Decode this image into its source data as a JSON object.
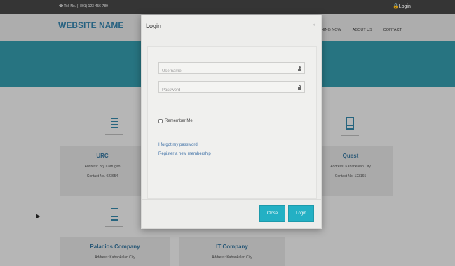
{
  "topbar": {
    "phone": "☎ Toll No. (+801) 123-456-789",
    "login": "🔒Login"
  },
  "site": {
    "brand": "WEBSITE NAME",
    "nav": [
      "HING NOW",
      "ABOUT US",
      "CONTACT"
    ]
  },
  "companies": [
    {
      "name": "URC",
      "address": "Address: Bry Carrugao",
      "contact": "Contact No. 023654"
    },
    {
      "name": "Quest",
      "address": "Address: Kabankalan City",
      "contact": "Contact No. 123165"
    },
    {
      "name": "Palacios Company",
      "address": "Address: Kabankalan City"
    },
    {
      "name": "IT Company",
      "address": "Address: Kabankalan City"
    }
  ],
  "modal": {
    "title": "Login",
    "close_symbol": "×",
    "username_placeholder": "Username",
    "password_placeholder": "Password",
    "remember_label": "Remember Me",
    "forgot_link": "I forgot my password",
    "register_link": "Register a new membership",
    "close_button": "Close",
    "login_button": "Login"
  },
  "colors": {
    "accent": "#23b0c4",
    "banner": "#2b7e8d",
    "brand": "#2b6b8d"
  }
}
